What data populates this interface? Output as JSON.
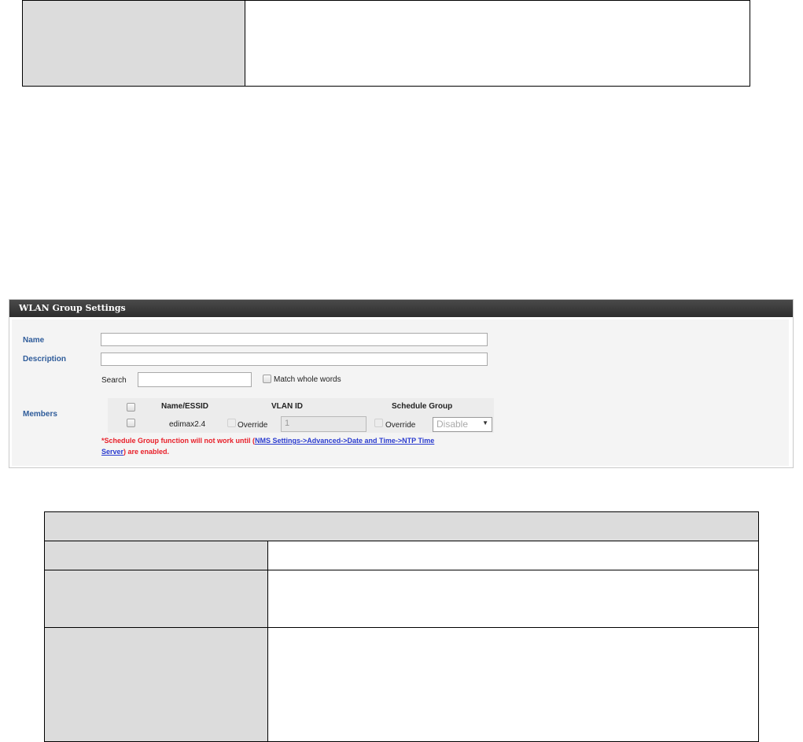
{
  "panel": {
    "title": "WLAN Group Settings",
    "name_label": "Name",
    "name_value": "",
    "description_label": "Description",
    "description_value": "",
    "search_label": "Search",
    "search_value": "",
    "match_label": "Match whole words",
    "members_label": "Members",
    "columns": [
      "Name/ESSID",
      "VLAN ID",
      "Schedule Group"
    ],
    "member": {
      "essid": "edimax2.4",
      "vlan_override_label": "Override",
      "vlan_value": "1",
      "schedule_override_label": "Override",
      "schedule_value": "Disable"
    },
    "warning_prefix": "*Schedule Group function will not work until (",
    "warning_link_1": "NMS Settings->Advanced->Date and Time->NTP Time",
    "warning_link_2": "Server",
    "warning_suffix": ") are enabled."
  },
  "colors": {
    "header_bg": "#3a3a3a",
    "label_blue": "#2f5c9a",
    "warning_red": "#e8202a",
    "link_blue": "#2b3ccf",
    "table_gray": "#dcdcdc"
  }
}
